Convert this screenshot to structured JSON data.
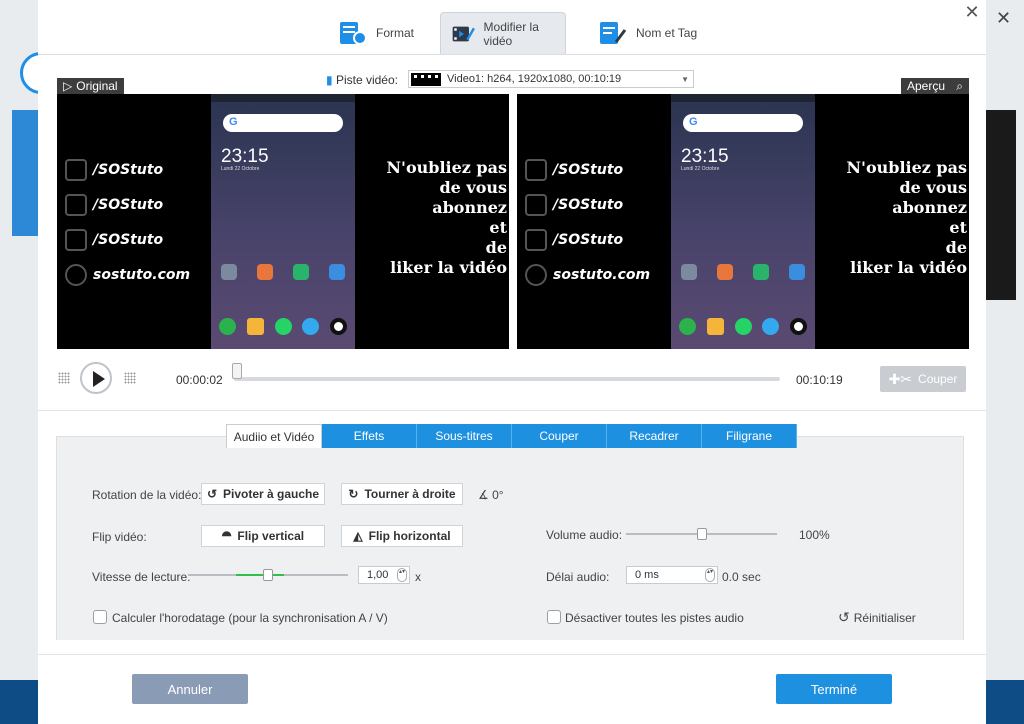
{
  "tabs": [
    {
      "label": "Format",
      "icon": "format-icon"
    },
    {
      "label": "Modifier la vidéo",
      "icon": "edit-video-icon"
    },
    {
      "label": "Nom et Tag",
      "icon": "tag-icon"
    }
  ],
  "track": {
    "label": "Piste vidéo:",
    "value": "Video1: h264, 1920x1080, 00:10:19"
  },
  "preview": {
    "original_label": "Original",
    "apercu_label": "Aperçu",
    "social": [
      "/SOStuto",
      "/SOStuto",
      "/SOStuto",
      "sostuto.com"
    ],
    "promo": [
      "N'oubliez pas",
      "de vous",
      "abonnez",
      "et",
      "de",
      "liker la vidéo"
    ],
    "phone_time": "23:15",
    "phone_date": "Lundi 22 Octobre"
  },
  "player": {
    "current_time": "00:00:02",
    "end_time": "00:10:19",
    "cut_label": "Couper",
    "progress": 0.0
  },
  "edit_tabs": [
    "Audiio et Vidéo",
    "Effets",
    "Sous-titres",
    "Couper",
    "Recadrer",
    "Filigrane"
  ],
  "rotation": {
    "label": "Rotation de la vidéo:",
    "left_btn": "Pivoter à gauche",
    "right_btn": "Tourner à droite",
    "angle": "0°"
  },
  "flip": {
    "label": "Flip vidéo:",
    "vertical_btn": "Flip vertical",
    "horizontal_btn": "Flip horizontal"
  },
  "speed": {
    "label": "Vitesse de lecture:",
    "value": "1,00",
    "unit": "x",
    "level": 0.5
  },
  "volume": {
    "label": "Volume audio:",
    "value": "100%",
    "level": 0.5
  },
  "delay": {
    "label": "Délai audio:",
    "value": "0 ms",
    "text": "0.0 sec"
  },
  "timestamp": {
    "label": "Calculer l'horodatage (pour la synchronisation A / V)",
    "checked": false
  },
  "disable_audio": {
    "label": "Désactiver toutes les pistes audio",
    "checked": false
  },
  "reset_label": "Réinitialiser",
  "footer": {
    "cancel": "Annuler",
    "done": "Terminé"
  },
  "colors": {
    "accent": "#1e90e0",
    "cancel": "#8a9bb5",
    "slider_fill": "#2fbf4b"
  }
}
